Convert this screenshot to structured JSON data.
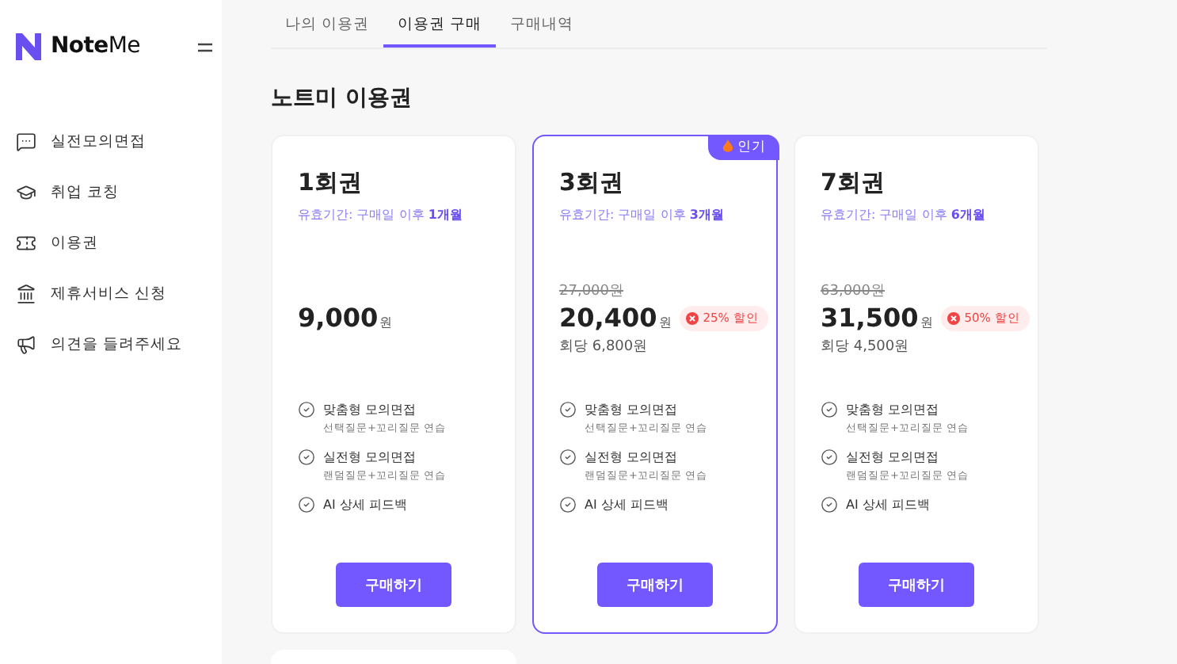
{
  "sidebar": {
    "logo": "**Note**Me",
    "items": [
      {
        "label": "실전모의면접",
        "selected": false
      },
      {
        "label": "취업 코칭",
        "selected": false
      },
      {
        "label": "이용권",
        "selected": false
      },
      {
        "label": "제휴서비스 신청",
        "selected": false
      },
      {
        "label": "의견을 들려주세요",
        "selected": false
      }
    ]
  },
  "tabs": [
    {
      "label": "나의 이용권",
      "selected": false
    },
    {
      "label": "이용권 구매",
      "selected": true
    },
    {
      "label": "구매내역",
      "selected": false
    }
  ],
  "heading": "노트미 이용권",
  "cards": [
    {
      "title": "1회권",
      "validity": "유효기간: 구매일 이후 **1개월**",
      "price": "9,000",
      "currency": "원",
      "selected": false,
      "features": [
        {
          "name": "맞춤형 모의면접",
          "detail": "선택질문+꼬리질문 연습"
        },
        {
          "name": "실전형 모의면접",
          "detail": "랜덤질문+꼬리질문 연습"
        },
        {
          "name": "AI 상세 피드백"
        }
      ],
      "button": "구매하기"
    },
    {
      "title": "3회권",
      "validity": "유효기간: 구매일 이후 **3개월**",
      "original_price": "27,000원",
      "price": "20,400",
      "currency": "원",
      "discount": "25% 할인",
      "per_use": "회당 6,800원",
      "badge": "인기",
      "selected": true,
      "features": [
        {
          "name": "맞춤형 모의면접",
          "detail": "선택질문+꼬리질문 연습"
        },
        {
          "name": "실전형 모의면접",
          "detail": "랜덤질문+꼬리질문 연습"
        },
        {
          "name": "AI 상세 피드백"
        }
      ],
      "button": "구매하기"
    },
    {
      "title": "7회권",
      "validity": "유효기간: 구매일 이후 **6개월**",
      "original_price": "63,000원",
      "price": "31,500",
      "currency": "원",
      "discount": "50% 할인",
      "per_use": "회당 4,500원",
      "selected": false,
      "features": [
        {
          "name": "맞춤형 모의면접",
          "detail": "선택질문+꼬리질문 연습"
        },
        {
          "name": "실전형 모의면접",
          "detail": "랜덤질문+꼬리질문 연습"
        },
        {
          "name": "AI 상세 피드백"
        }
      ],
      "button": "구매하기"
    }
  ]
}
